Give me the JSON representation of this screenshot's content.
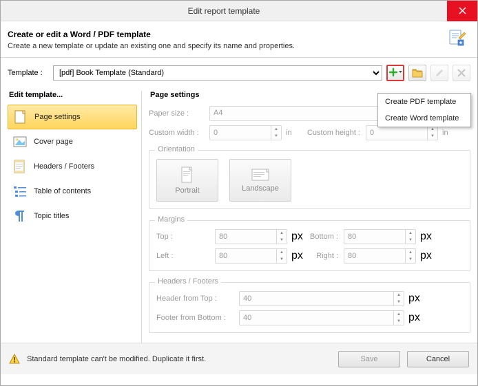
{
  "window": {
    "title": "Edit report template"
  },
  "header": {
    "title": "Create or edit a Word / PDF template",
    "subtitle": "Create a new template or update an existing one and specify its name and properties."
  },
  "template_row": {
    "label": "Template :",
    "value": "[pdf] Book Template (Standard)"
  },
  "dropdown": {
    "item1": "Create PDF template",
    "item2": "Create Word template"
  },
  "sidebar": {
    "title": "Edit template...",
    "items": {
      "page_settings": "Page settings",
      "cover_page": "Cover page",
      "headers_footers": "Headers / Footers",
      "toc": "Table of contents",
      "topic_titles": "Topic titles"
    }
  },
  "main": {
    "title": "Page settings",
    "paper": {
      "label": "Paper size :",
      "value": "A4"
    },
    "custom": {
      "wlabel": "Custom width :",
      "wvalue": "0",
      "wunit": "in",
      "hlabel": "Custom height :",
      "hvalue": "0",
      "hunit": "in"
    },
    "orientation": {
      "title": "Orientation",
      "portrait": "Portrait",
      "landscape": "Landscape"
    },
    "margins": {
      "title": "Margins",
      "top_l": "Top :",
      "top_v": "80",
      "bottom_l": "Bottom :",
      "bottom_v": "80",
      "left_l": "Left :",
      "left_v": "80",
      "right_l": "Right :",
      "right_v": "80",
      "unit": "px"
    },
    "hf": {
      "title": "Headers / Footers",
      "ht_l": "Header from Top :",
      "ht_v": "40",
      "fb_l": "Footer from Bottom :",
      "fb_v": "40",
      "unit": "px"
    }
  },
  "footer": {
    "warning": "Standard template can't be modified. Duplicate it first.",
    "save": "Save",
    "cancel": "Cancel"
  }
}
